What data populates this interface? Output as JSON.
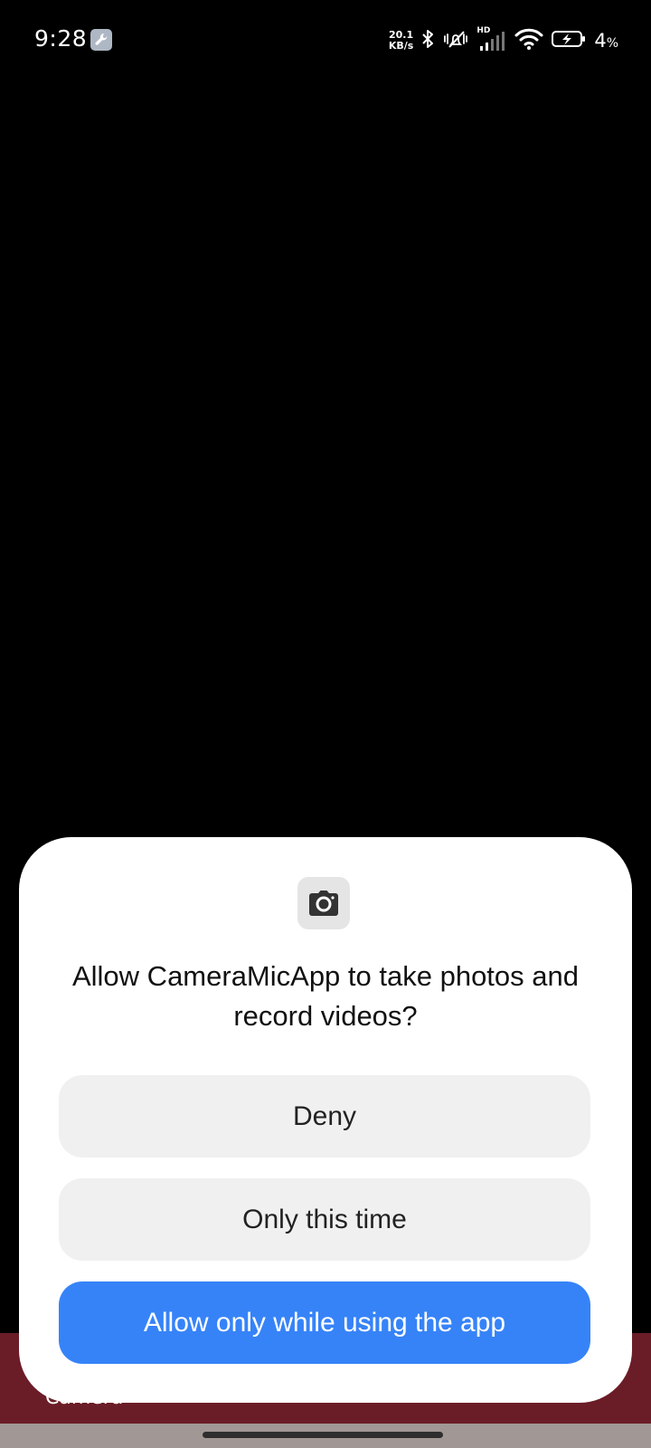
{
  "status_bar": {
    "time": "9:28",
    "net_speed_value": "20.1",
    "net_speed_unit": "KB/s",
    "network_type": "HD",
    "battery_percent": "4",
    "battery_percent_sign": "%",
    "icons": [
      "wrench-icon",
      "bluetooth-icon",
      "vibrate-icon",
      "signal-icon",
      "wifi-icon",
      "battery-charging-icon"
    ]
  },
  "background_app": {
    "bottom_label": "Camera",
    "bar_color": "#6b1d27"
  },
  "dialog": {
    "icon": "camera-icon",
    "title": "Allow CameraMicApp to take photos and record videos?",
    "buttons": {
      "deny": "Deny",
      "only_this_time": "Only this time",
      "allow_while_using": "Allow only while using the app"
    },
    "accent_color": "#3683f8"
  }
}
